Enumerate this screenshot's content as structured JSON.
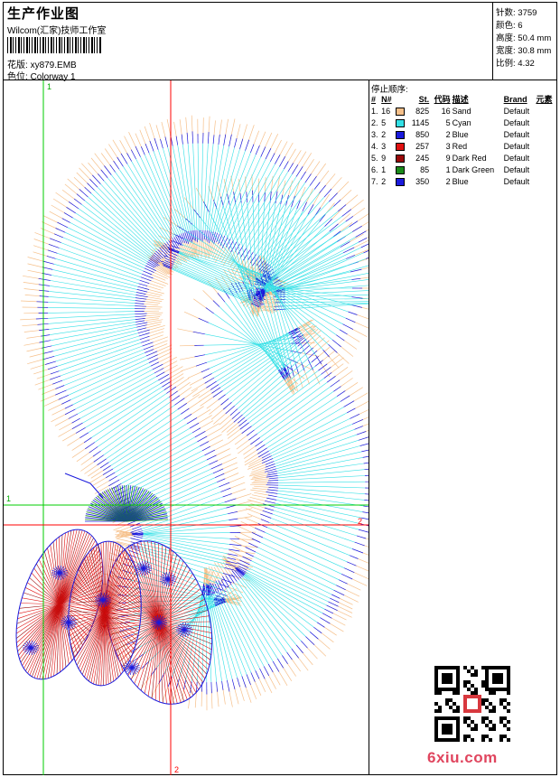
{
  "header": {
    "title": "生产作业图",
    "company": "Wilcom(汇家)技师工作室",
    "design_label": "花版:",
    "design_value": "xy879.EMB",
    "color_label": "色位:",
    "color_value": "Colorway 1"
  },
  "stats": {
    "stitches_label": "针数:",
    "stitches": "3759",
    "colors_label": "颜色:",
    "colors": "6",
    "height_label": "高度:",
    "height": "50.4 mm",
    "width_label": "宽度:",
    "width": "30.8 mm",
    "scale_label": "比例:",
    "scale": "4.32"
  },
  "stop_sequence": {
    "title": "停止顺序:",
    "headers": {
      "idx": "#",
      "needle": "N#",
      "stitches": "St.",
      "code": "代码",
      "desc": "描述",
      "brand": "Brand",
      "element": "元素"
    },
    "rows": [
      {
        "idx": "1.",
        "needle": "16",
        "color": "#f6c08a",
        "stitches": "825",
        "code": "16",
        "desc": "Sand",
        "brand": "Default"
      },
      {
        "idx": "2.",
        "needle": "5",
        "color": "#33e0e6",
        "stitches": "1145",
        "code": "5",
        "desc": "Cyan",
        "brand": "Default"
      },
      {
        "idx": "3.",
        "needle": "2",
        "color": "#1a1adc",
        "stitches": "850",
        "code": "2",
        "desc": "Blue",
        "brand": "Default"
      },
      {
        "idx": "4.",
        "needle": "3",
        "color": "#e01010",
        "stitches": "257",
        "code": "3",
        "desc": "Red",
        "brand": "Default"
      },
      {
        "idx": "5.",
        "needle": "9",
        "color": "#9a0a0a",
        "stitches": "245",
        "code": "9",
        "desc": "Dark Red",
        "brand": "Default"
      },
      {
        "idx": "6.",
        "needle": "1",
        "color": "#1a8a1a",
        "stitches": "85",
        "code": "1",
        "desc": "Dark Green",
        "brand": "Default"
      },
      {
        "idx": "7.",
        "needle": "2",
        "color": "#1a1adc",
        "stitches": "350",
        "code": "2",
        "desc": "Blue",
        "brand": "Default"
      }
    ]
  },
  "canvas": {
    "guide_labels": [
      "1",
      "1",
      "2",
      "2"
    ],
    "colors": {
      "sand": "#f6c08a",
      "cyan": "#33e0e6",
      "blue": "#1a1adc",
      "red": "#e01010",
      "dark_red": "#9a0a0a",
      "dark_green": "#1a8a1a",
      "guide_green": "#00cc00",
      "guide_red": "#ff0000"
    }
  },
  "watermark": {
    "icon": "qr-code-icon",
    "site": "6xiu.com"
  }
}
